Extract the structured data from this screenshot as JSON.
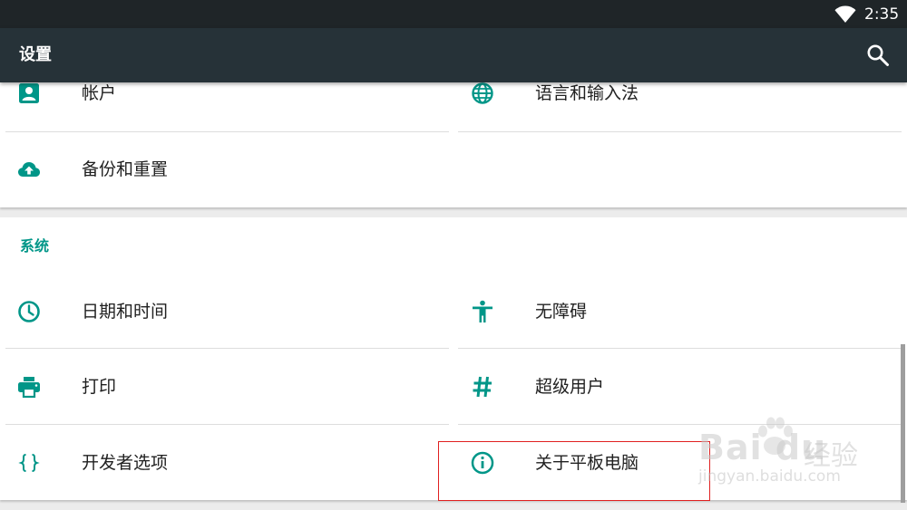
{
  "status_bar": {
    "time": "2:35",
    "wifi_icon": "wifi-icon"
  },
  "toolbar": {
    "title": "设置",
    "search_icon": "search-icon"
  },
  "card_top": {
    "items": [
      {
        "label": "帐户",
        "icon": "account-icon"
      },
      {
        "label": "语言和输入法",
        "icon": "globe-icon"
      },
      {
        "label": "备份和重置",
        "icon": "cloud-upload-icon"
      }
    ]
  },
  "system_section": {
    "header": "系统",
    "items": [
      {
        "label": "日期和时间",
        "icon": "clock-icon"
      },
      {
        "label": "无障碍",
        "icon": "accessibility-icon"
      },
      {
        "label": "打印",
        "icon": "printer-icon"
      },
      {
        "label": "超级用户",
        "icon": "hash-icon"
      },
      {
        "label": "开发者选项",
        "icon": "braces-icon"
      },
      {
        "label": "关于平板电脑",
        "icon": "info-icon"
      }
    ]
  },
  "watermark": {
    "brand": "Bai du",
    "cn": "经验",
    "url": "jingyan.baidu.com"
  },
  "colors": {
    "accent": "#009688",
    "toolbar": "#263238",
    "status_bar": "#1f2528",
    "highlight": "#e02020"
  }
}
